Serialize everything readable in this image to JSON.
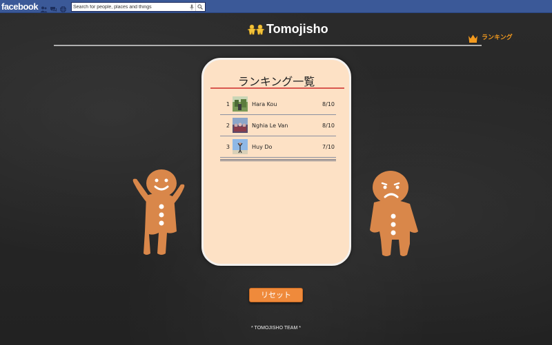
{
  "facebook": {
    "logo": "facebook",
    "search_placeholder": "Search for people, places and things",
    "icons": [
      "friend-requests-icon",
      "messages-icon",
      "notifications-icon",
      "mic-icon",
      "search-icon"
    ]
  },
  "header": {
    "title": "Tomojisho",
    "ranking_link": "ランキング"
  },
  "ranking": {
    "title": "ランキング一覧",
    "rows": [
      {
        "rank": "1",
        "name": "Hara Kou",
        "score": "8/10"
      },
      {
        "rank": "2",
        "name": "Nghia Le Van",
        "score": "8/10"
      },
      {
        "rank": "3",
        "name": "Huy Do",
        "score": "7/10"
      }
    ]
  },
  "reset_button": "リセット",
  "footer": "* TOMOJISHO TEAM *",
  "colors": {
    "facebook_blue": "#3b5998",
    "accent_orange": "#f39a1e",
    "card_bg": "#fde1c5",
    "title_underline": "#d9574e",
    "button_orange": "#ef8a3b"
  }
}
